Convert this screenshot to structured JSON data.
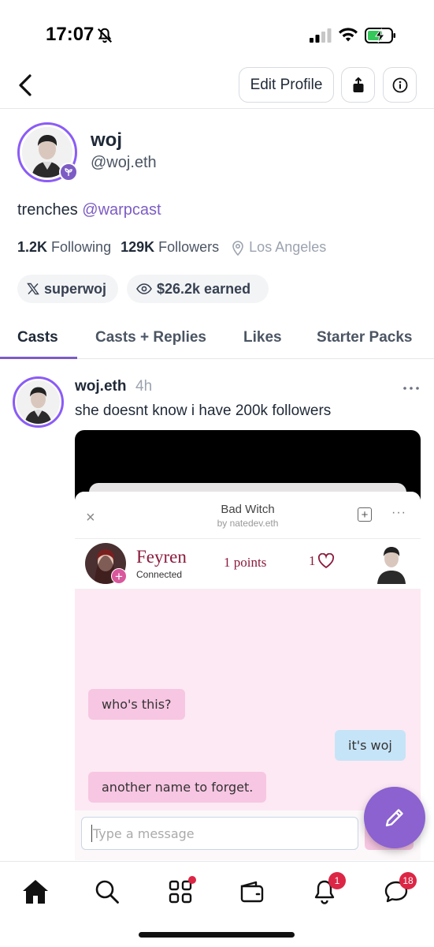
{
  "status_bar": {
    "time": "17:07"
  },
  "header": {
    "edit_profile_label": "Edit Profile"
  },
  "profile": {
    "display_name": "woj",
    "username": "@woj.eth",
    "bio_text": "trenches",
    "bio_mention": "@warpcast",
    "following_count": "1.2K",
    "following_label": "Following",
    "followers_count": "129K",
    "followers_label": "Followers",
    "location": "Los Angeles",
    "x_handle": "superwoj",
    "earned": "$26.2k earned"
  },
  "tabs": [
    {
      "label": "Casts",
      "active": true
    },
    {
      "label": "Casts + Replies",
      "active": false
    },
    {
      "label": "Likes",
      "active": false
    },
    {
      "label": "Starter Packs",
      "active": false
    }
  ],
  "cast": {
    "author": "woj.eth",
    "time": "4h",
    "text": "she doesnt know i have 200k followers",
    "embed": {
      "close_glyph": "×",
      "title": "Bad Witch",
      "byline": "by natedev.eth",
      "add_glyph": "+",
      "more_glyph": "···",
      "player_name": "Feyren",
      "player_status": "Connected",
      "points": "1 points",
      "likes": "1",
      "messages": [
        {
          "text": "who's this?",
          "from": "other"
        },
        {
          "text": "it's woj",
          "from": "self"
        },
        {
          "text": "another name to forget.",
          "from": "other"
        }
      ],
      "input_placeholder": "Type a message"
    }
  },
  "nav": {
    "items": [
      "home-icon",
      "search-icon",
      "apps-icon",
      "wallet-icon",
      "notifications-icon",
      "messages-icon"
    ],
    "notifications_badge": "1",
    "messages_badge": "18"
  },
  "colors": {
    "accent": "#7c5cc4",
    "badge": "#dc2645",
    "fab": "#8b62d0"
  }
}
